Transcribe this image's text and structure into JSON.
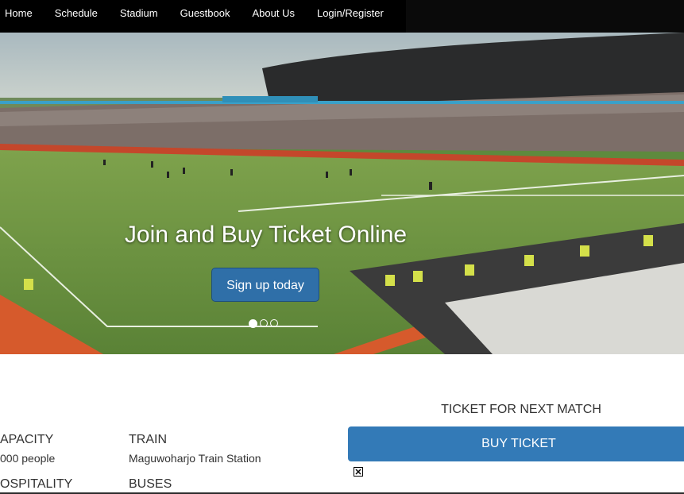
{
  "nav": {
    "items": [
      "Home",
      "Schedule",
      "Stadium",
      "Guestbook",
      "About Us",
      "Login/Register"
    ]
  },
  "hero": {
    "caption": "Join and Buy Ticket Online",
    "button_label": "Sign up today",
    "slides_total": 3,
    "active_slide": 1
  },
  "info": {
    "capacity_label": "APACITY",
    "capacity_value": "000 people",
    "hospitality_label": "OSPITALITY",
    "train_label": "TRAIN",
    "train_value": "Maguwoharjo Train Station",
    "buses_label": "BUSES"
  },
  "ticket": {
    "heading": "TICKET FOR NEXT MATCH",
    "button_label": "BUY TICKET"
  },
  "colors": {
    "navbar": "#000000",
    "primary": "#337ab7",
    "hero_button": "#2f6fa8"
  }
}
